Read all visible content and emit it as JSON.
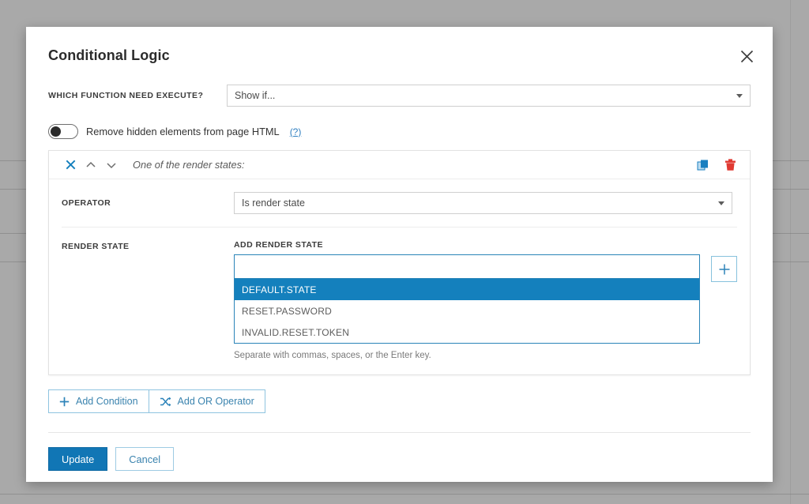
{
  "modal": {
    "title": "Conditional Logic",
    "close_icon": "close-icon"
  },
  "function_field": {
    "label": "WHICH FUNCTION NEED EXECUTE?",
    "value": "Show if..."
  },
  "remove_hidden": {
    "label": "Remove hidden elements from page HTML",
    "help_label": "(?)",
    "state": "off"
  },
  "condition": {
    "title": "One of the render states:",
    "remove_icon": "close-icon",
    "move_up_icon": "chevron-up-icon",
    "move_down_icon": "chevron-down-icon",
    "duplicate_icon": "copy-icon",
    "delete_icon": "trash-icon",
    "operator": {
      "label": "OPERATOR",
      "value": "Is render state"
    },
    "render_state": {
      "label": "RENDER STATE",
      "input_label": "ADD RENDER STATE",
      "input_value": "",
      "hint": "Separate with commas, spaces, or the Enter key.",
      "add_icon": "plus-icon",
      "suggestions": [
        {
          "label": "DEFAULT.STATE",
          "selected": true
        },
        {
          "label": "RESET.PASSWORD",
          "selected": false
        },
        {
          "label": "INVALID.RESET.TOKEN",
          "selected": false
        }
      ]
    }
  },
  "actions": {
    "add_condition": "Add Condition",
    "add_condition_icon": "plus-icon",
    "add_or_operator": "Add OR Operator",
    "add_or_operator_icon": "shuffle-icon"
  },
  "footer": {
    "update": "Update",
    "cancel": "Cancel"
  },
  "colors": {
    "accent": "#1176b5",
    "link": "#3a83ae",
    "danger": "#e03a32",
    "highlight": "#1480bd"
  }
}
